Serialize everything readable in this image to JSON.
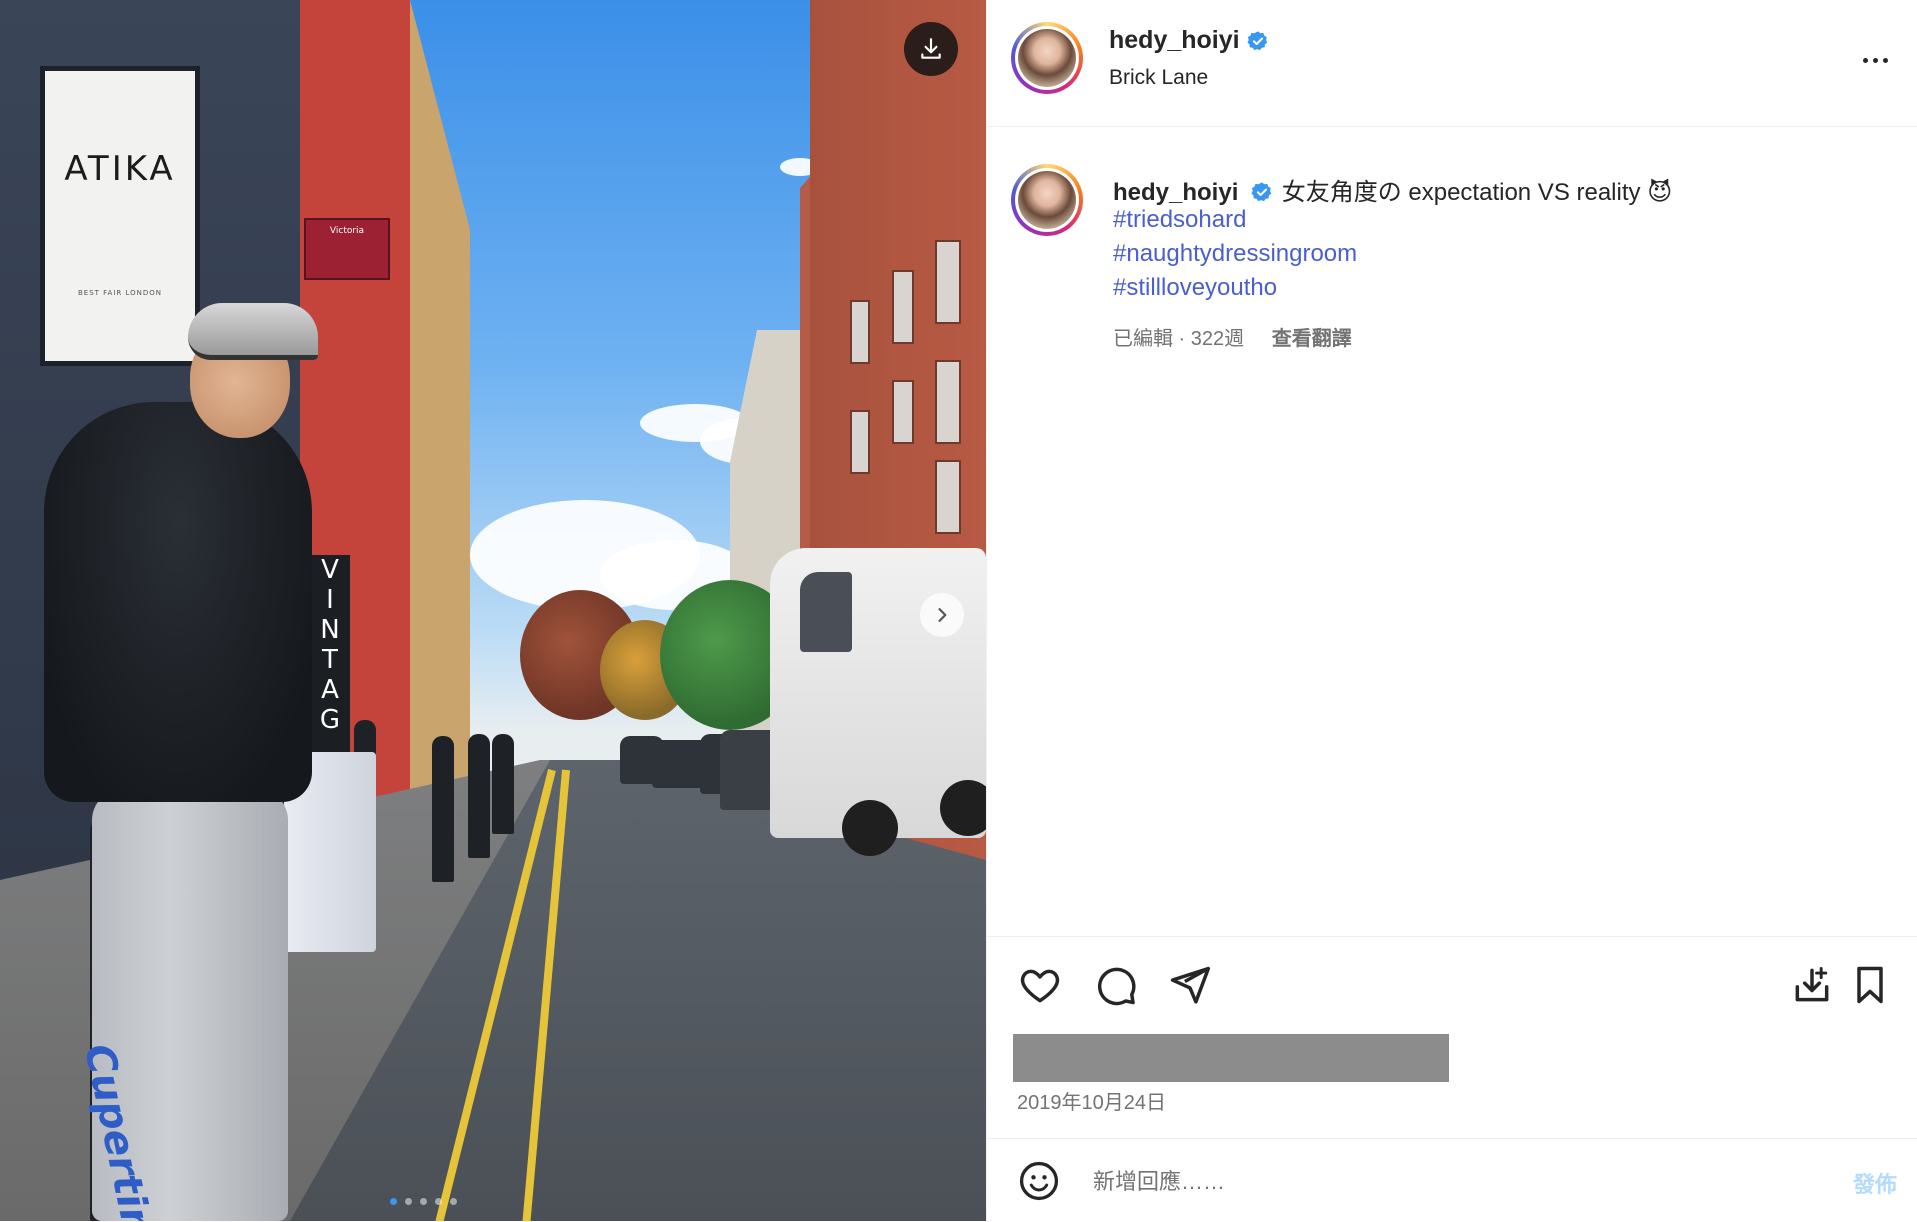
{
  "post": {
    "username": "hedy_hoiyi",
    "verified": true,
    "location": "Brick Lane",
    "caption": {
      "text": "女友角度の expectation VS reality",
      "emoji": "😈",
      "hashtags": [
        "#triedsohard",
        "#naughtydressingroom",
        "#stillloveyoutho"
      ]
    },
    "meta": {
      "edited_age": "已編輯 · 322週",
      "see_translation": "查看翻譯"
    },
    "date": "2019年10月24日"
  },
  "photo": {
    "sign_text": "ATIKA",
    "sign_subtext": "BEST FAIR LONDON",
    "red_sign_text": "Victoria",
    "vintage_letters": [
      "V",
      "I",
      "N",
      "T",
      "A",
      "G"
    ],
    "pants_text": "Cupertino",
    "carousel_dots": 5,
    "active_dot": 0
  },
  "comment": {
    "placeholder": "新增回應……",
    "post_label": "發佈"
  },
  "icons": {
    "download": "download-icon",
    "next": "chevron-right-icon",
    "more": "more-options-icon",
    "like": "heart-icon",
    "comment": "comment-icon",
    "share": "send-icon",
    "save_image": "save-image-icon",
    "bookmark": "bookmark-icon",
    "emoji": "emoji-icon",
    "verified": "verified-badge-icon"
  },
  "colors": {
    "link": "#4a5fcf",
    "meta_text": "#737373",
    "verified": "#3897f0",
    "post_button": "#b3dbff",
    "likes_redaction": "#8c8c8c"
  }
}
